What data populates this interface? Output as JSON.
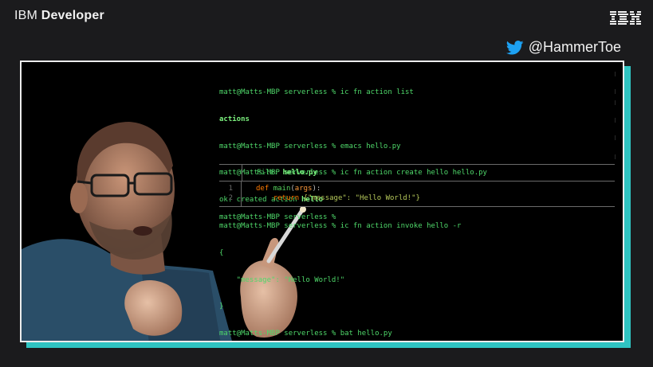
{
  "brand": {
    "light": "IBM",
    "bold": "Developer"
  },
  "social": {
    "handle": "@HammerToe"
  },
  "terminal": {
    "lines": [
      "matt@Matts-MBP serverless % ic fn action list",
      "actions",
      "matt@Matts-MBP serverless % emacs hello.py",
      "matt@Matts-MBP serverless % ic fn action create hello hello.py",
      "ok: created action ",
      "matt@Matts-MBP serverless % ic fn action invoke hello -r",
      "{",
      "    \"message\": \"Hello World!\"",
      "}",
      "matt@Matts-MBP serverless % bat hello.py"
    ],
    "created_name": "hello",
    "final_prompt": "matt@Matts-MBP serverless % "
  },
  "bat": {
    "file_label": "File: ",
    "file_name": "hello.py",
    "line_numbers": [
      "1",
      "2"
    ],
    "code": {
      "def": "def",
      "fn_name": "main",
      "paren_open": "(",
      "arg": "args",
      "paren_close": "):",
      "return": "return",
      "body": " {\"message\": \"Hello World!\"}"
    }
  },
  "colors": {
    "background": "#1b1b1d",
    "terminal_green": "#4fd86a",
    "accent_teal": "#2fc4c2",
    "keyword_orange": "#ff7a00"
  }
}
